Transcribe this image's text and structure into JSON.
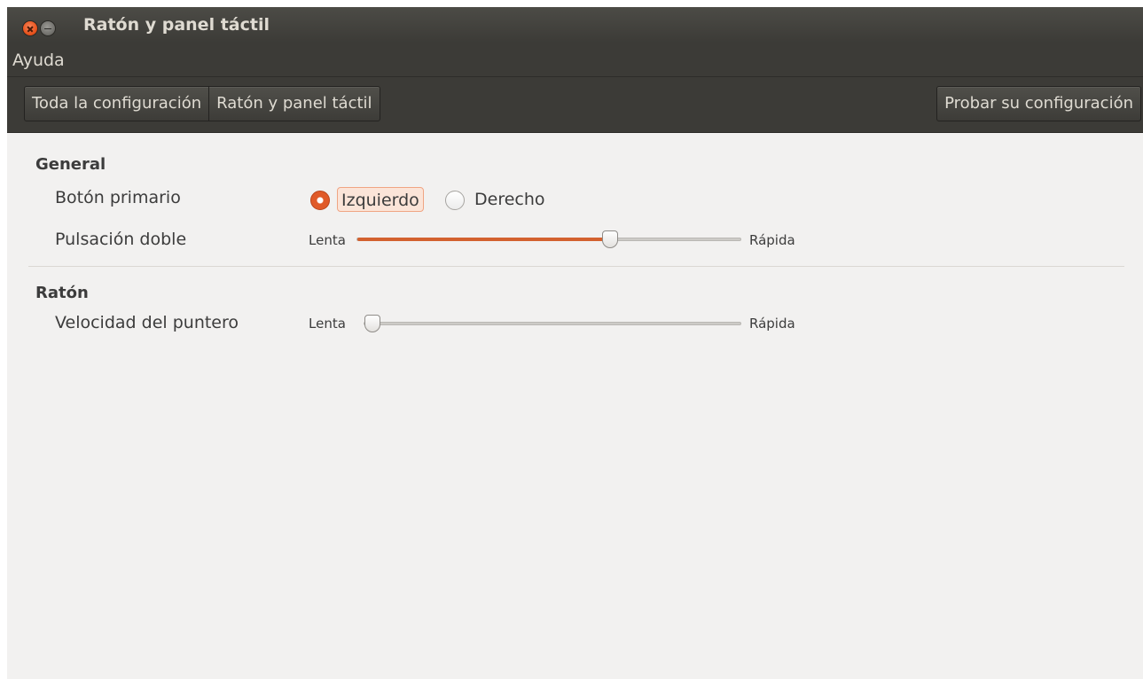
{
  "window": {
    "title": "Ratón y panel táctil",
    "menu": [
      "Ayuda"
    ]
  },
  "toolbar": {
    "breadcrumbs": [
      "Toda la configuración",
      "Ratón y panel táctil"
    ],
    "test_button": "Probar su configuración"
  },
  "general": {
    "title": "General",
    "primary_button": {
      "label": "Botón primario",
      "options": [
        "Izquierdo",
        "Derecho"
      ],
      "selected": "Izquierdo"
    },
    "double_click": {
      "label": "Pulsación doble",
      "min_label": "Lenta",
      "max_label": "Rápida",
      "value_fraction": 0.66
    }
  },
  "mouse": {
    "title": "Ratón",
    "pointer_speed": {
      "label": "Velocidad del puntero",
      "min_label": "Lenta",
      "max_label": "Rápida",
      "value_fraction": 0.0
    }
  },
  "icons": {
    "close": "close-icon",
    "minimize": "minimize-icon"
  },
  "colors": {
    "accent": "#d3612f",
    "titlebar": "#3c3b37",
    "background": "#f2f1f0"
  }
}
